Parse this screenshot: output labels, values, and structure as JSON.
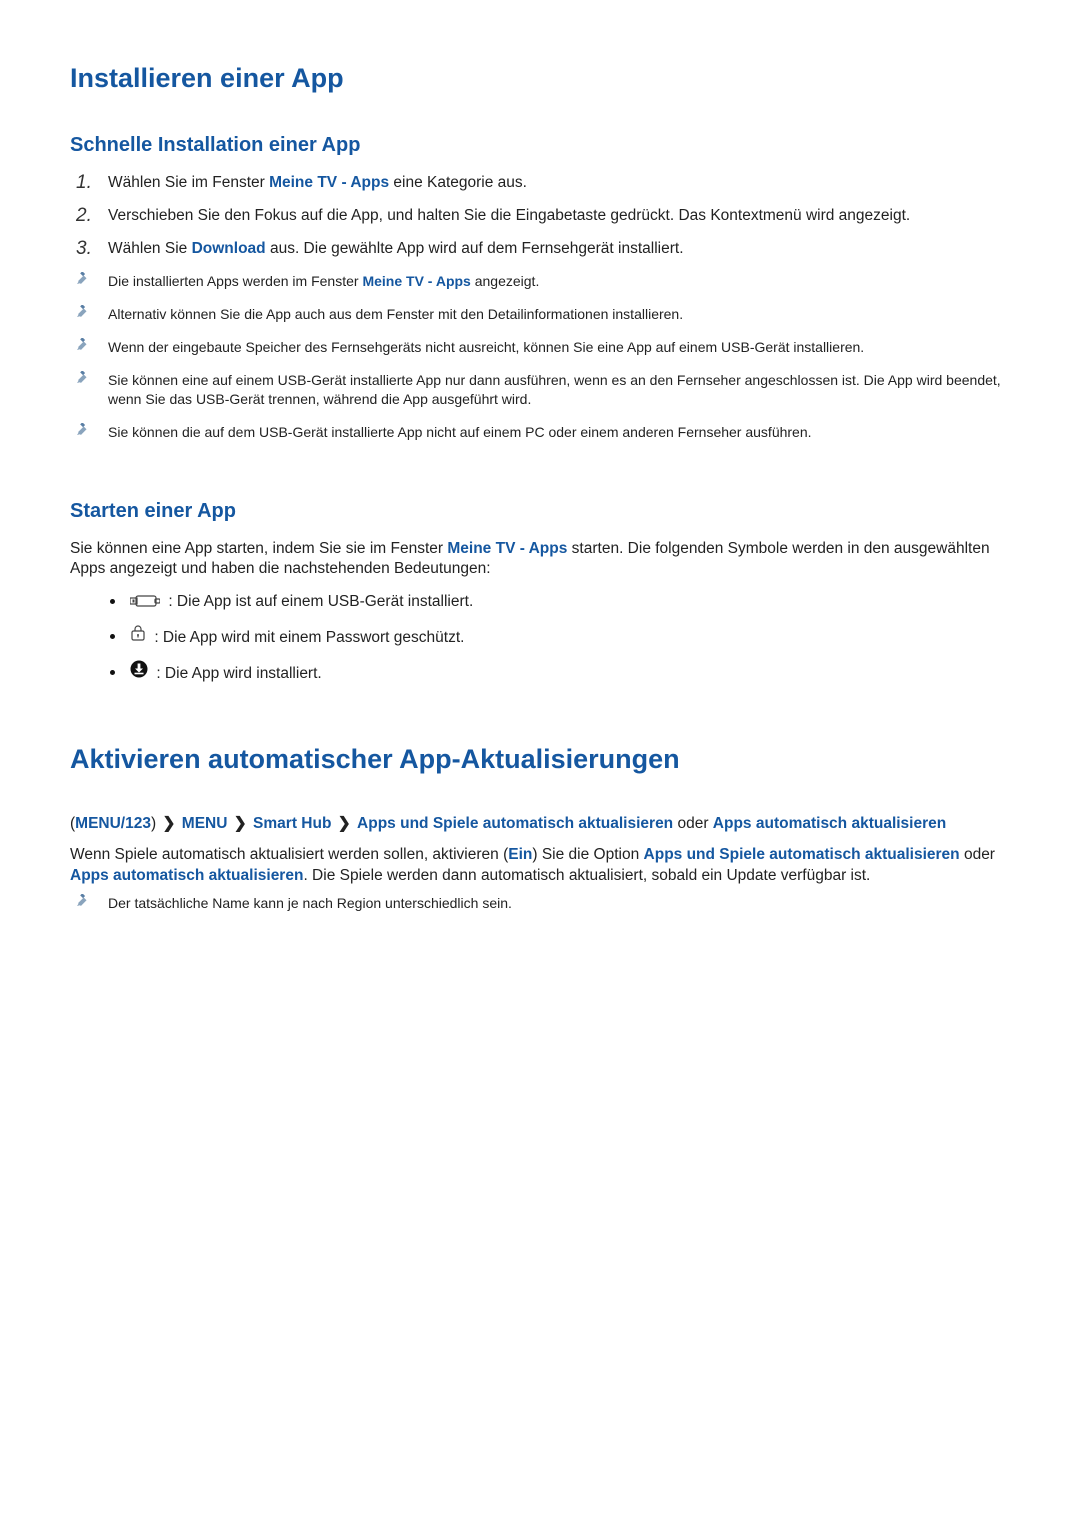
{
  "section1": {
    "title": "Installieren einer App",
    "sub1": {
      "title": "Schnelle Installation einer App",
      "steps": [
        {
          "n": "1.",
          "pre": "Wählen Sie im Fenster ",
          "hl": "Meine TV - Apps",
          "post": " eine Kategorie aus."
        },
        {
          "n": "2.",
          "text": "Verschieben Sie den Fokus auf die App, und halten Sie die Eingabetaste gedrückt. Das Kontextmenü wird angezeigt."
        },
        {
          "n": "3.",
          "pre": "Wählen Sie ",
          "hl": "Download",
          "post": " aus. Die gewählte App wird auf dem Fernsehgerät installiert."
        }
      ],
      "notes": [
        {
          "pre": "Die installierten Apps werden im Fenster ",
          "hl": "Meine TV - Apps",
          "post": " angezeigt."
        },
        {
          "text": "Alternativ können Sie die App auch aus dem Fenster mit den Detailinformationen installieren."
        },
        {
          "text": "Wenn der eingebaute Speicher des Fernsehgeräts nicht ausreicht, können Sie eine App auf einem USB-Gerät installieren."
        },
        {
          "text": "Sie können eine auf einem USB-Gerät installierte App nur dann ausführen, wenn es an den Fernseher angeschlossen ist. Die App wird beendet, wenn Sie das USB-Gerät trennen, während die App ausgeführt wird."
        },
        {
          "text": "Sie können die auf dem USB-Gerät installierte App nicht auf einem PC oder einem anderen Fernseher ausführen."
        }
      ]
    },
    "sub2": {
      "title": "Starten einer App",
      "intro_pre": "Sie können eine App starten, indem Sie sie im Fenster ",
      "intro_hl": "Meine TV - Apps",
      "intro_post": " starten. Die folgenden Symbole werden in den ausgewählten Apps angezeigt und haben die nachstehenden Bedeutungen:",
      "items": [
        {
          "icon": "usb",
          "text": " : Die App ist auf einem USB-Gerät installiert."
        },
        {
          "icon": "lock",
          "text": " : Die App wird mit einem Passwort geschützt."
        },
        {
          "icon": "download",
          "text": " : Die App wird installiert."
        }
      ]
    }
  },
  "section2": {
    "title": "Aktivieren automatischer App-Aktualisierungen",
    "path": {
      "open": "(",
      "p1": "MENU/123",
      "close": ")",
      "p2": "MENU",
      "p3": "Smart Hub",
      "p4": "Apps und Spiele automatisch aktualisieren",
      "or": " oder ",
      "p5": "Apps automatisch aktualisieren"
    },
    "body": {
      "t1": "Wenn Spiele automatisch aktualisiert werden sollen, aktivieren (",
      "on": "Ein",
      "t2": ") Sie die Option ",
      "opt1": "Apps und Spiele automatisch aktualisieren",
      "or": " oder ",
      "opt2": "Apps automatisch aktualisieren",
      "t3": ". Die Spiele werden dann automatisch aktualisiert, sobald ein Update verfügbar ist."
    },
    "note": "Der tatsächliche Name kann je nach Region unterschiedlich sein."
  }
}
